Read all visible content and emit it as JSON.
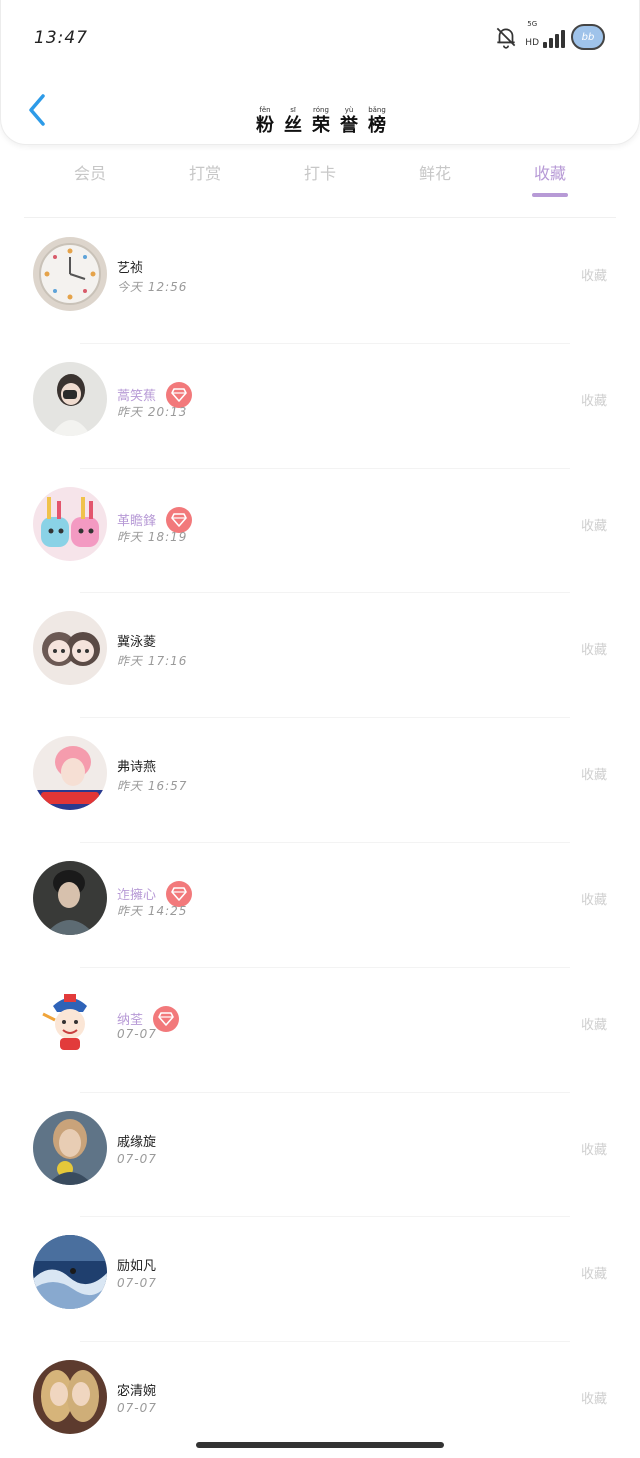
{
  "status_bar": {
    "time": "13:47",
    "network": "5G",
    "network_sub": "HD",
    "battery_label": "bb"
  },
  "header": {
    "title_chars": [
      {
        "py": "fěn",
        "hz": "粉"
      },
      {
        "py": "sī",
        "hz": "丝"
      },
      {
        "py": "róng",
        "hz": "荣"
      },
      {
        "py": "yù",
        "hz": "誉"
      },
      {
        "py": "bǎng",
        "hz": "榜"
      }
    ]
  },
  "tabs": [
    {
      "label": "会员",
      "active": false
    },
    {
      "label": "打赏",
      "active": false
    },
    {
      "label": "打卡",
      "active": false
    },
    {
      "label": "鲜花",
      "active": false
    },
    {
      "label": "收藏",
      "active": true
    }
  ],
  "colors": {
    "accent": "#b79ad6",
    "vip_badge": "#f2797b"
  },
  "fans": [
    {
      "name": "艺祯",
      "time": "今天 12:56",
      "vip": false,
      "action": "收藏",
      "avatar": "clock"
    },
    {
      "name": "蒿笑蕉",
      "time": "昨天 20:13",
      "vip": true,
      "action": "收藏",
      "avatar": "girl"
    },
    {
      "name": "革瞻鋒",
      "time": "昨天 18:19",
      "vip": true,
      "action": "收藏",
      "avatar": "toys"
    },
    {
      "name": "冀泳菱",
      "time": "昨天 17:16",
      "vip": false,
      "action": "收藏",
      "avatar": "cats"
    },
    {
      "name": "弗诗燕",
      "time": "昨天 16:57",
      "vip": false,
      "action": "收藏",
      "avatar": "pinkhair"
    },
    {
      "name": "迮擁心",
      "time": "昨天 14:25",
      "vip": true,
      "action": "收藏",
      "avatar": "man"
    },
    {
      "name": "纳荃",
      "time": "07-07",
      "vip": true,
      "action": "收藏",
      "avatar": "cartoon"
    },
    {
      "name": "戚缘旋",
      "time": "07-07",
      "vip": false,
      "action": "收藏",
      "avatar": "woman"
    },
    {
      "name": "励如凡",
      "time": "07-07",
      "vip": false,
      "action": "收藏",
      "avatar": "wave"
    },
    {
      "name": "宓清婉",
      "time": "07-07",
      "vip": false,
      "action": "收藏",
      "avatar": "twins"
    }
  ]
}
